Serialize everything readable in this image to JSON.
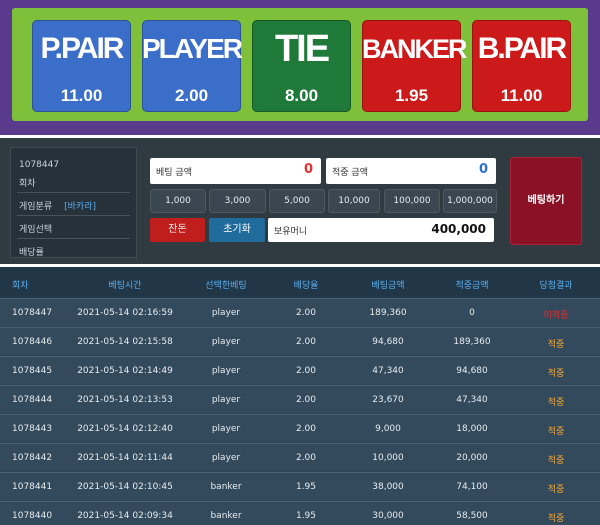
{
  "colors": {
    "frame_purple": "#5a3a8c",
    "inner_green": "#7ec03a",
    "player_blue": "#3a6ec8",
    "tie_green": "#1f7a3a",
    "banker_red": "#cc1a1a",
    "win_orange": "#f2a93a",
    "lose_red": "#e03030",
    "header_blue": "#5aaef0"
  },
  "bet_types": [
    {
      "name": "P.PAIR",
      "odds": "11.00",
      "color": "#3a6ec8",
      "size": 30
    },
    {
      "name": "PLAYER",
      "odds": "2.00",
      "color": "#3a6ec8",
      "size": 28
    },
    {
      "name": "TIE",
      "odds": "8.00",
      "color": "#1f7a3a",
      "size": 38
    },
    {
      "name": "BANKER",
      "odds": "1.95",
      "color": "#cc1a1a",
      "size": 27
    },
    {
      "name": "B.PAIR",
      "odds": "11.00",
      "color": "#cc1a1a",
      "size": 30
    }
  ],
  "info": {
    "round_number": "1078447",
    "round_label": "회차",
    "category_label": "게임분류",
    "category_value": "[바카라]",
    "selection_label": "게임선택",
    "odds_label": "배당률"
  },
  "bet_amount": {
    "label": "베팅 금액",
    "value": "0",
    "color": "#e03030"
  },
  "win_amount": {
    "label": "적중 금액",
    "value": "0",
    "color": "#2d6fd6"
  },
  "chips": [
    "1,000",
    "3,000",
    "5,000",
    "10,000",
    "100,000",
    "1,000,000"
  ],
  "actions": {
    "allin_label": "잔돈",
    "reset_label": "초기화",
    "balance_label": "보유머니",
    "balance_value": "400,000",
    "place_bet_label": "베팅하기"
  },
  "history": {
    "columns": [
      "회차",
      "베팅시간",
      "선택한베팅",
      "배당율",
      "베팅금액",
      "적중금액",
      "당첨결과"
    ],
    "rows": [
      {
        "round": "1078447",
        "time": "2021-05-14 02:16:59",
        "pick": "player",
        "odds": "2.00",
        "bet": "189,360",
        "win": "0",
        "result": "미적중",
        "result_color": "#e03030"
      },
      {
        "round": "1078446",
        "time": "2021-05-14 02:15:58",
        "pick": "player",
        "odds": "2.00",
        "bet": "94,680",
        "win": "189,360",
        "result": "적중",
        "result_color": "#f2a93a"
      },
      {
        "round": "1078445",
        "time": "2021-05-14 02:14:49",
        "pick": "player",
        "odds": "2.00",
        "bet": "47,340",
        "win": "94,680",
        "result": "적중",
        "result_color": "#f2a93a"
      },
      {
        "round": "1078444",
        "time": "2021-05-14 02:13:53",
        "pick": "player",
        "odds": "2.00",
        "bet": "23,670",
        "win": "47,340",
        "result": "적중",
        "result_color": "#f2a93a"
      },
      {
        "round": "1078443",
        "time": "2021-05-14 02:12:40",
        "pick": "player",
        "odds": "2.00",
        "bet": "9,000",
        "win": "18,000",
        "result": "적중",
        "result_color": "#f2a93a"
      },
      {
        "round": "1078442",
        "time": "2021-05-14 02:11:44",
        "pick": "player",
        "odds": "2.00",
        "bet": "10,000",
        "win": "20,000",
        "result": "적중",
        "result_color": "#f2a93a"
      },
      {
        "round": "1078441",
        "time": "2021-05-14 02:10:45",
        "pick": "banker",
        "odds": "1.95",
        "bet": "38,000",
        "win": "74,100",
        "result": "적중",
        "result_color": "#f2a93a"
      },
      {
        "round": "1078440",
        "time": "2021-05-14 02:09:34",
        "pick": "banker",
        "odds": "1.95",
        "bet": "30,000",
        "win": "58,500",
        "result": "적중",
        "result_color": "#f2a93a"
      }
    ]
  }
}
